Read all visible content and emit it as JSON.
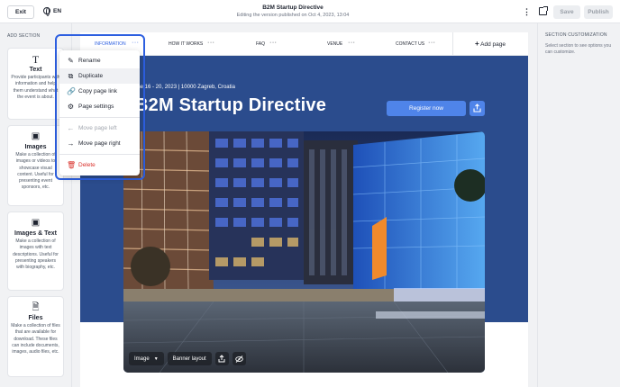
{
  "topbar": {
    "exit_label": "Exit",
    "language": "EN",
    "doc_title": "B2M Startup Directive",
    "doc_subtitle": "Editing the version published on Oct 4, 2023, 13:04",
    "save_label": "Save",
    "publish_label": "Publish"
  },
  "left_panel": {
    "title": "ADD SECTION",
    "cards": [
      {
        "title": "Text",
        "desc": "Provide participants with information and help them understand what the event is about."
      },
      {
        "title": "Images",
        "desc": "Make a collection of images or videos to showcase visual content. Useful for presenting event sponsors, etc."
      },
      {
        "title": "Images & Text",
        "desc": "Make a collection of images with text descriptions. Useful for presenting speakers with biography, etc."
      },
      {
        "title": "Files",
        "desc": "Make a collection of files that are available for download. These files can include documents, images, audio files, etc."
      }
    ]
  },
  "right_panel": {
    "title": "SECTION CUSTOMIZATION",
    "desc": "Select section to see options you can customize."
  },
  "nav": {
    "items": [
      {
        "label": "INFORMATION",
        "active": true
      },
      {
        "label": "HOW IT WORKS"
      },
      {
        "label": "FAQ"
      },
      {
        "label": "VENUE"
      },
      {
        "label": "CONTACT US"
      }
    ],
    "add_page": "Add page"
  },
  "hero": {
    "date_location": "June 16 - 20, 2023  |  10000 Zagreb, Croatia",
    "title": "B2M Startup Directive",
    "register_label": "Register now"
  },
  "image_toolbar": {
    "type_label": "Image",
    "layout_label": "Banner layout"
  },
  "context_menu": {
    "rename": "Rename",
    "duplicate": "Duplicate",
    "copy_link": "Copy page link",
    "settings": "Page settings",
    "move_left": "Move page left",
    "move_right": "Move page right",
    "delete": "Delete"
  },
  "colors": {
    "accent": "#2d5fe0",
    "hero_bg": "#2b4c8d",
    "button_blue": "#4f84e9",
    "danger": "#d9322c"
  }
}
